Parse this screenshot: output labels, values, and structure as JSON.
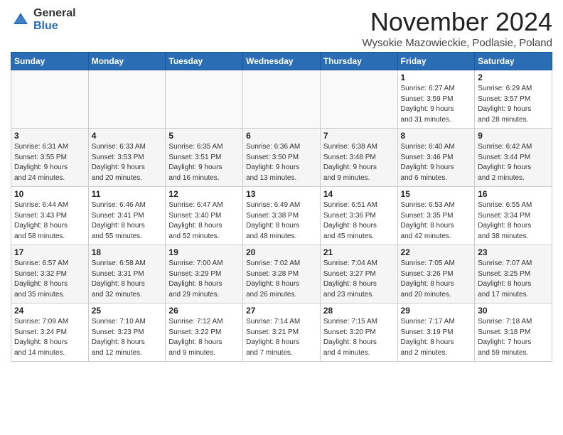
{
  "logo": {
    "general": "General",
    "blue": "Blue"
  },
  "title": "November 2024",
  "location": "Wysokie Mazowieckie, Podlasie, Poland",
  "days_of_week": [
    "Sunday",
    "Monday",
    "Tuesday",
    "Wednesday",
    "Thursday",
    "Friday",
    "Saturday"
  ],
  "weeks": [
    {
      "row_class": "row-white",
      "days": [
        {
          "num": "",
          "info": "",
          "empty": true
        },
        {
          "num": "",
          "info": "",
          "empty": true
        },
        {
          "num": "",
          "info": "",
          "empty": true
        },
        {
          "num": "",
          "info": "",
          "empty": true
        },
        {
          "num": "",
          "info": "",
          "empty": true
        },
        {
          "num": "1",
          "info": "Sunrise: 6:27 AM\nSunset: 3:59 PM\nDaylight: 9 hours\nand 31 minutes."
        },
        {
          "num": "2",
          "info": "Sunrise: 6:29 AM\nSunset: 3:57 PM\nDaylight: 9 hours\nand 28 minutes."
        }
      ]
    },
    {
      "row_class": "row-gray",
      "days": [
        {
          "num": "3",
          "info": "Sunrise: 6:31 AM\nSunset: 3:55 PM\nDaylight: 9 hours\nand 24 minutes."
        },
        {
          "num": "4",
          "info": "Sunrise: 6:33 AM\nSunset: 3:53 PM\nDaylight: 9 hours\nand 20 minutes."
        },
        {
          "num": "5",
          "info": "Sunrise: 6:35 AM\nSunset: 3:51 PM\nDaylight: 9 hours\nand 16 minutes."
        },
        {
          "num": "6",
          "info": "Sunrise: 6:36 AM\nSunset: 3:50 PM\nDaylight: 9 hours\nand 13 minutes."
        },
        {
          "num": "7",
          "info": "Sunrise: 6:38 AM\nSunset: 3:48 PM\nDaylight: 9 hours\nand 9 minutes."
        },
        {
          "num": "8",
          "info": "Sunrise: 6:40 AM\nSunset: 3:46 PM\nDaylight: 9 hours\nand 6 minutes."
        },
        {
          "num": "9",
          "info": "Sunrise: 6:42 AM\nSunset: 3:44 PM\nDaylight: 9 hours\nand 2 minutes."
        }
      ]
    },
    {
      "row_class": "row-white",
      "days": [
        {
          "num": "10",
          "info": "Sunrise: 6:44 AM\nSunset: 3:43 PM\nDaylight: 8 hours\nand 58 minutes."
        },
        {
          "num": "11",
          "info": "Sunrise: 6:46 AM\nSunset: 3:41 PM\nDaylight: 8 hours\nand 55 minutes."
        },
        {
          "num": "12",
          "info": "Sunrise: 6:47 AM\nSunset: 3:40 PM\nDaylight: 8 hours\nand 52 minutes."
        },
        {
          "num": "13",
          "info": "Sunrise: 6:49 AM\nSunset: 3:38 PM\nDaylight: 8 hours\nand 48 minutes."
        },
        {
          "num": "14",
          "info": "Sunrise: 6:51 AM\nSunset: 3:36 PM\nDaylight: 8 hours\nand 45 minutes."
        },
        {
          "num": "15",
          "info": "Sunrise: 6:53 AM\nSunset: 3:35 PM\nDaylight: 8 hours\nand 42 minutes."
        },
        {
          "num": "16",
          "info": "Sunrise: 6:55 AM\nSunset: 3:34 PM\nDaylight: 8 hours\nand 38 minutes."
        }
      ]
    },
    {
      "row_class": "row-gray",
      "days": [
        {
          "num": "17",
          "info": "Sunrise: 6:57 AM\nSunset: 3:32 PM\nDaylight: 8 hours\nand 35 minutes."
        },
        {
          "num": "18",
          "info": "Sunrise: 6:58 AM\nSunset: 3:31 PM\nDaylight: 8 hours\nand 32 minutes."
        },
        {
          "num": "19",
          "info": "Sunrise: 7:00 AM\nSunset: 3:29 PM\nDaylight: 8 hours\nand 29 minutes."
        },
        {
          "num": "20",
          "info": "Sunrise: 7:02 AM\nSunset: 3:28 PM\nDaylight: 8 hours\nand 26 minutes."
        },
        {
          "num": "21",
          "info": "Sunrise: 7:04 AM\nSunset: 3:27 PM\nDaylight: 8 hours\nand 23 minutes."
        },
        {
          "num": "22",
          "info": "Sunrise: 7:05 AM\nSunset: 3:26 PM\nDaylight: 8 hours\nand 20 minutes."
        },
        {
          "num": "23",
          "info": "Sunrise: 7:07 AM\nSunset: 3:25 PM\nDaylight: 8 hours\nand 17 minutes."
        }
      ]
    },
    {
      "row_class": "row-white",
      "days": [
        {
          "num": "24",
          "info": "Sunrise: 7:09 AM\nSunset: 3:24 PM\nDaylight: 8 hours\nand 14 minutes."
        },
        {
          "num": "25",
          "info": "Sunrise: 7:10 AM\nSunset: 3:23 PM\nDaylight: 8 hours\nand 12 minutes."
        },
        {
          "num": "26",
          "info": "Sunrise: 7:12 AM\nSunset: 3:22 PM\nDaylight: 8 hours\nand 9 minutes."
        },
        {
          "num": "27",
          "info": "Sunrise: 7:14 AM\nSunset: 3:21 PM\nDaylight: 8 hours\nand 7 minutes."
        },
        {
          "num": "28",
          "info": "Sunrise: 7:15 AM\nSunset: 3:20 PM\nDaylight: 8 hours\nand 4 minutes."
        },
        {
          "num": "29",
          "info": "Sunrise: 7:17 AM\nSunset: 3:19 PM\nDaylight: 8 hours\nand 2 minutes."
        },
        {
          "num": "30",
          "info": "Sunrise: 7:18 AM\nSunset: 3:18 PM\nDaylight: 7 hours\nand 59 minutes."
        }
      ]
    }
  ]
}
